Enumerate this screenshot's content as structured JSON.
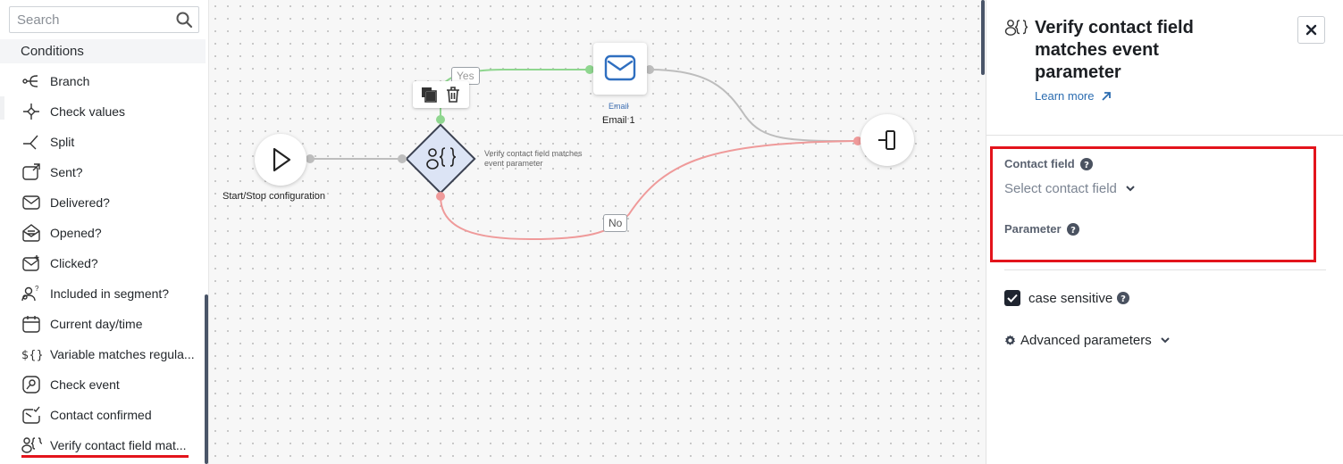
{
  "sidebar": {
    "search_placeholder": "Search",
    "section_title": "Conditions",
    "items": [
      {
        "label": "Branch",
        "icon": "branch-icon"
      },
      {
        "label": "Check values",
        "icon": "check-values-icon"
      },
      {
        "label": "Split",
        "icon": "split-icon"
      },
      {
        "label": "Sent?",
        "icon": "sent-icon"
      },
      {
        "label": "Delivered?",
        "icon": "delivered-icon"
      },
      {
        "label": "Opened?",
        "icon": "opened-icon"
      },
      {
        "label": "Clicked?",
        "icon": "clicked-icon"
      },
      {
        "label": "Included in segment?",
        "icon": "segment-icon"
      },
      {
        "label": "Current day/time",
        "icon": "calendar-icon"
      },
      {
        "label": "Variable matches regula...",
        "icon": "variable-regex-icon"
      },
      {
        "label": "Check event",
        "icon": "check-event-icon"
      },
      {
        "label": "Contact confirmed",
        "icon": "contact-confirmed-icon"
      },
      {
        "label": "Verify contact field mat...",
        "icon": "verify-contact-field-icon"
      }
    ]
  },
  "canvas": {
    "start_label": "Start/Stop configuration",
    "email_type": "Email",
    "email_name": "Email 1",
    "verify_caption": "Verify contact field matches event parameter",
    "yes_label": "Yes",
    "no_label": "No",
    "colors": {
      "yes": "#8fd68f",
      "no": "#ef9a9a",
      "neutral": "#bdbdbd"
    }
  },
  "panel": {
    "title": "Verify contact field matches event parameter",
    "learn_more": "Learn more",
    "contact_field_label": "Contact field",
    "contact_field_placeholder": "Select contact field",
    "parameter_label": "Parameter",
    "case_sensitive_label": "case sensitive",
    "case_sensitive_checked": true,
    "advanced_label": "Advanced parameters"
  }
}
